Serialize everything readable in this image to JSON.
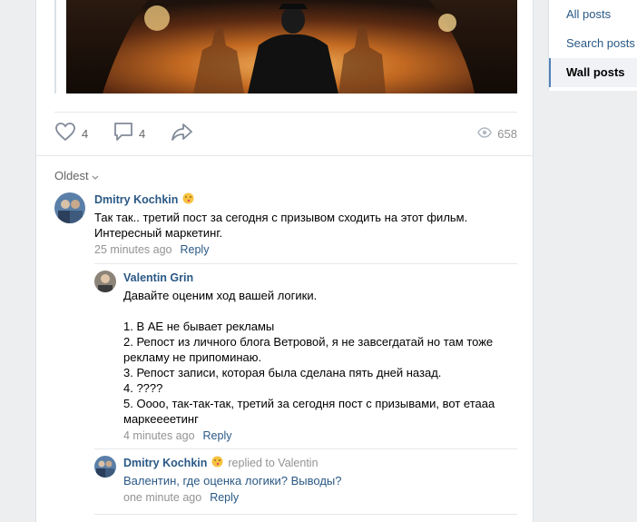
{
  "post": {
    "likes_count": "4",
    "comments_count": "4",
    "views_count": "658"
  },
  "comments_sort_label": "Oldest",
  "comments": [
    {
      "author": "Dmitry Kochkin",
      "text": "Так так.. третий пост за сегодня с призывом сходить на этот фильм.\nИнтересный маркетинг.",
      "time": "25 minutes ago",
      "reply_label": "Reply"
    },
    {
      "author": "Valentin Grin",
      "text": "Давайте оценим ход вашей логики.\n\n1. В АЕ не бывает рекламы\n2. Репост из личного блога Ветровой, я не завсегдатай но там тоже\nрекламу не припоминаю.\n3. Репост записи, которая была сделана пять дней назад.\n4. ????\n5. Оооо, так-так-так, третий за сегодня пост с призывами, вот етааа\nмаркеееетинг",
      "time": "4 minutes ago",
      "reply_label": "Reply"
    },
    {
      "author": "Dmitry Kochkin",
      "replied_to": "replied to Valentin",
      "text_link": "Валентин",
      "text_rest": ", где оценка логики? Выводы?",
      "time": "one minute ago",
      "reply_label": "Reply"
    }
  ],
  "sidebar": {
    "items": [
      {
        "label": "All posts"
      },
      {
        "label": "Search posts"
      },
      {
        "label": "Wall posts"
      }
    ]
  },
  "colors": {
    "link": "#2a5885",
    "meta": "#939393",
    "active_marker": "#5181b8"
  }
}
